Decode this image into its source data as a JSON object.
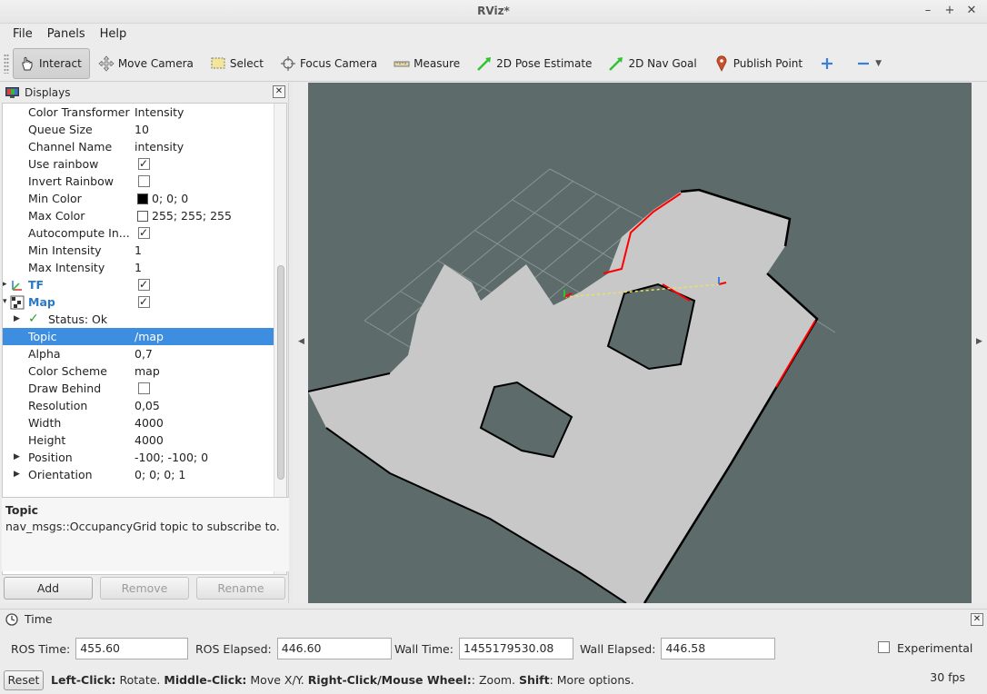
{
  "window": {
    "title": "RViz*"
  },
  "menu": [
    "File",
    "Panels",
    "Help"
  ],
  "toolbar": {
    "tools": [
      {
        "label": "Interact",
        "icon": "hand-icon",
        "active": true
      },
      {
        "label": "Move Camera",
        "icon": "move-icon"
      },
      {
        "label": "Select",
        "icon": "select-icon"
      },
      {
        "label": "Focus Camera",
        "icon": "focus-icon"
      },
      {
        "label": "Measure",
        "icon": "ruler-icon"
      },
      {
        "label": "2D Pose Estimate",
        "icon": "green-arrow-icon"
      },
      {
        "label": "2D Nav Goal",
        "icon": "green-arrow-icon"
      },
      {
        "label": "Publish Point",
        "icon": "map-pin-icon"
      }
    ]
  },
  "displays": {
    "title": "Displays",
    "rows": [
      {
        "key": "Color Transformer",
        "value": "Intensity"
      },
      {
        "key": "Queue Size",
        "value": "10"
      },
      {
        "key": "Channel Name",
        "value": "intensity"
      },
      {
        "key": "Use rainbow",
        "check": true
      },
      {
        "key": "Invert Rainbow",
        "check": false
      },
      {
        "key": "Min Color",
        "value": "0; 0; 0",
        "swatch": "#000000"
      },
      {
        "key": "Max Color",
        "value": "255; 255; 255",
        "swatch": "#ffffff"
      },
      {
        "key": "Autocompute In...",
        "check": true
      },
      {
        "key": "Min Intensity",
        "value": "1"
      },
      {
        "key": "Max Intensity",
        "value": "1"
      },
      {
        "key": "TF",
        "check": true,
        "group": true
      },
      {
        "key": "Map",
        "check": true,
        "group": true
      },
      {
        "key": "Status: Ok",
        "status": true
      },
      {
        "key": "Topic",
        "value": "/map",
        "selected": true
      },
      {
        "key": "Alpha",
        "value": "0,7"
      },
      {
        "key": "Color Scheme",
        "value": "map"
      },
      {
        "key": "Draw Behind",
        "check": false
      },
      {
        "key": "Resolution",
        "value": "0,05"
      },
      {
        "key": "Width",
        "value": "4000"
      },
      {
        "key": "Height",
        "value": "4000"
      },
      {
        "key": "Position",
        "value": "-100; -100; 0",
        "expand": true
      },
      {
        "key": "Orientation",
        "value": "0; 0; 0; 1",
        "expand": true
      }
    ],
    "description": {
      "heading": "Topic",
      "text": "nav_msgs::OccupancyGrid topic to subscribe to."
    },
    "buttons": {
      "add": "Add",
      "remove": "Remove",
      "rename": "Rename"
    }
  },
  "time": {
    "title": "Time",
    "ros_time_label": "ROS Time:",
    "ros_time": "455.60",
    "ros_elapsed_label": "ROS Elapsed:",
    "ros_elapsed": "446.60",
    "wall_time_label": "Wall Time:",
    "wall_time": "1455179530.08",
    "wall_elapsed_label": "Wall Elapsed:",
    "wall_elapsed": "446.58",
    "experimental_label": "Experimental"
  },
  "status": {
    "reset": "Reset",
    "hint_parts": [
      "Left-Click:",
      " Rotate. ",
      "Middle-Click:",
      " Move X/Y. ",
      "Right-Click/Mouse Wheel:",
      ": Zoom. ",
      "Shift",
      ": More options."
    ],
    "fps": "30 fps"
  },
  "colors": {
    "viewport_bg": "#5d6b6b",
    "map_free": "#c8c8c8",
    "wall": "#000000",
    "laser": "#ff0000"
  }
}
